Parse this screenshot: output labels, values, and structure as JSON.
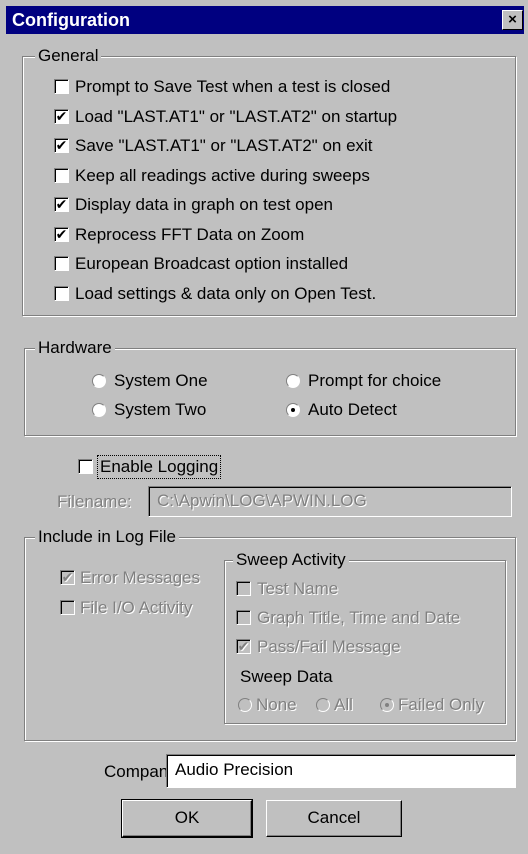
{
  "window": {
    "title": "Configuration",
    "close_glyph": "×"
  },
  "general": {
    "label": "General",
    "items": [
      {
        "label": "Prompt to Save Test  when a test is closed",
        "checked": false
      },
      {
        "label": "Load \"LAST.AT1\" or \"LAST.AT2\" on startup",
        "checked": true
      },
      {
        "label": "Save \"LAST.AT1\" or \"LAST.AT2\" on exit",
        "checked": true
      },
      {
        "label": "Keep all readings active during sweeps",
        "checked": false
      },
      {
        "label": "Display data in graph on test open",
        "checked": true
      },
      {
        "label": "Reprocess FFT Data on Zoom",
        "checked": true
      },
      {
        "label": "European Broadcast option installed",
        "checked": false
      },
      {
        "label": "Load settings & data only on Open Test.",
        "checked": false
      }
    ]
  },
  "hardware": {
    "label": "Hardware",
    "options": [
      {
        "label": "System One",
        "selected": false
      },
      {
        "label": "Prompt for choice",
        "selected": false
      },
      {
        "label": "System Two",
        "selected": false
      },
      {
        "label": "Auto Detect",
        "selected": true
      }
    ]
  },
  "logging": {
    "enable_label": "Enable Logging",
    "enabled": false,
    "filename_label": "Filename:",
    "filename_value": "C:\\Apwin\\LOG\\APWIN.LOG"
  },
  "log_file": {
    "label": "Include in Log File",
    "error_messages": {
      "label": "Error Messages",
      "checked": true
    },
    "file_io": {
      "label": "File I/O Activity",
      "checked": false
    },
    "sweep_activity": {
      "label": "Sweep Activity",
      "items": [
        {
          "label": "Test Name",
          "checked": false
        },
        {
          "label": "Graph Title, Time and Date",
          "checked": false
        },
        {
          "label": "Pass/Fail Message",
          "checked": true
        }
      ]
    },
    "sweep_data": {
      "label": "Sweep Data",
      "options": [
        {
          "label": "None",
          "selected": false
        },
        {
          "label": "All",
          "selected": false
        },
        {
          "label": "Failed Only",
          "selected": true
        }
      ]
    }
  },
  "company": {
    "label": "Company",
    "value": "Audio Precision"
  },
  "buttons": {
    "ok": "OK",
    "cancel": "Cancel"
  },
  "glyphs": {
    "check": "✔"
  }
}
